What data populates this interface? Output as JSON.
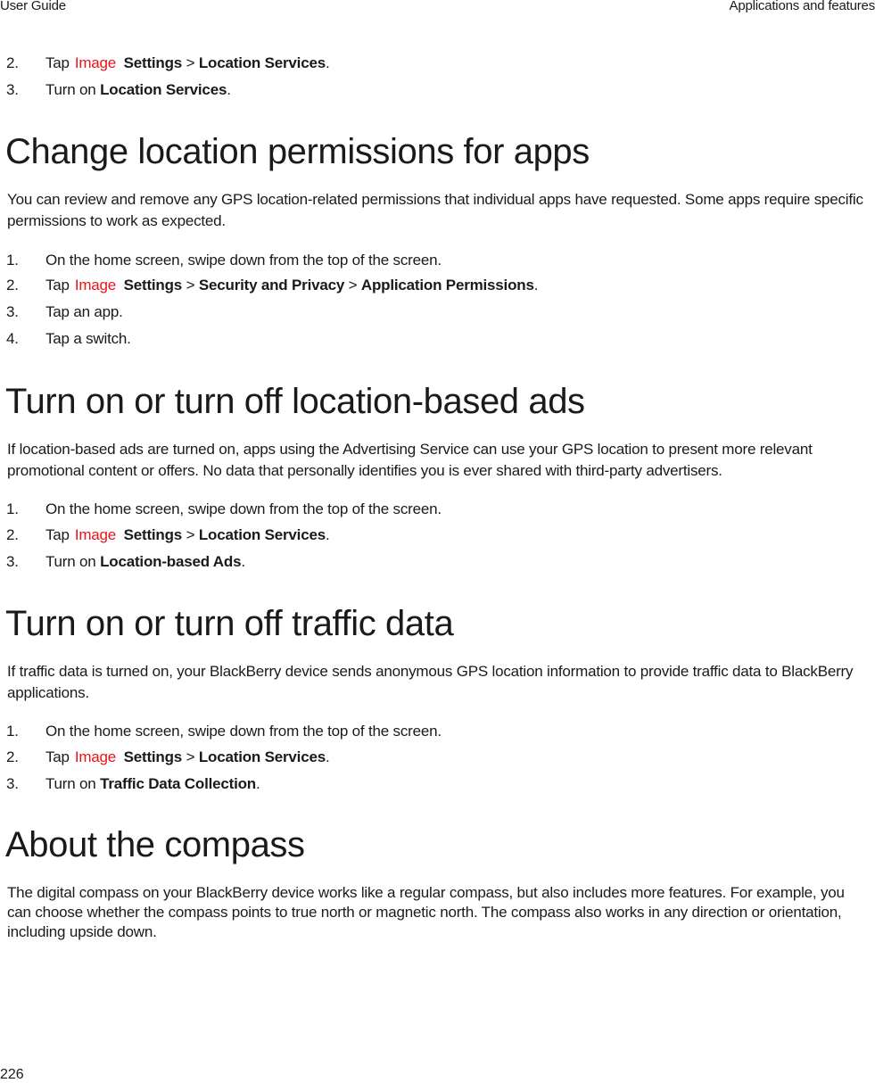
{
  "header": {
    "left": "User Guide",
    "right": "Applications and features"
  },
  "footer": {
    "page_number": "226"
  },
  "intro_steps": [
    {
      "num": "2.",
      "pre": "Tap",
      "image": "Image",
      "b1": "Settings",
      "sep1": ">",
      "b2": "Location Services",
      "end": "."
    },
    {
      "num": "3.",
      "pre": "Turn on",
      "b1": "Location Services",
      "end": "."
    }
  ],
  "sections": [
    {
      "title": "Change location permissions for apps",
      "body": "You can review and remove any GPS location-related permissions that individual apps have requested. Some apps require specific permissions to work as expected.",
      "steps": [
        {
          "num": "1.",
          "text": "On the home screen, swipe down from the top of the screen."
        },
        {
          "num": "2.",
          "pre": "Tap",
          "image": "Image",
          "b1": "Settings",
          "sep1": ">",
          "b2": "Security and Privacy",
          "sep2": ">",
          "b3": "Application Permissions",
          "end": "."
        },
        {
          "num": "3.",
          "text": "Tap an app."
        },
        {
          "num": "4.",
          "text": "Tap a switch."
        }
      ]
    },
    {
      "title": "Turn on or turn off location-based ads",
      "body": "If location-based ads are turned on, apps using the Advertising Service can use your GPS location to present more relevant promotional content or offers. No data that personally identifies you is ever shared with third-party advertisers.",
      "steps": [
        {
          "num": "1.",
          "text": "On the home screen, swipe down from the top of the screen."
        },
        {
          "num": "2.",
          "pre": "Tap",
          "image": "Image",
          "b1": "Settings",
          "sep1": ">",
          "b2": "Location Services",
          "end": "."
        },
        {
          "num": "3.",
          "pre": "Turn on",
          "b1": "Location-based Ads",
          "end": "."
        }
      ]
    },
    {
      "title": "Turn on or turn off traffic data",
      "body": "If traffic data is turned on, your BlackBerry device sends anonymous GPS location information to provide traffic data to BlackBerry applications.",
      "steps": [
        {
          "num": "1.",
          "text": "On the home screen, swipe down from the top of the screen."
        },
        {
          "num": "2.",
          "pre": "Tap",
          "image": "Image",
          "b1": "Settings",
          "sep1": ">",
          "b2": "Location Services",
          "end": "."
        },
        {
          "num": "3.",
          "pre": "Turn on",
          "b1": "Traffic Data Collection",
          "end": "."
        }
      ]
    },
    {
      "title": "About the compass",
      "body": "The digital compass on your BlackBerry device works like a regular compass, but also includes more features. For example, you can choose whether the compass points to true north or magnetic north. The compass also works in any direction or orientation, including upside down."
    }
  ],
  "colors": {
    "image_placeholder": "#e8141b",
    "text": "#1a1a1a"
  }
}
